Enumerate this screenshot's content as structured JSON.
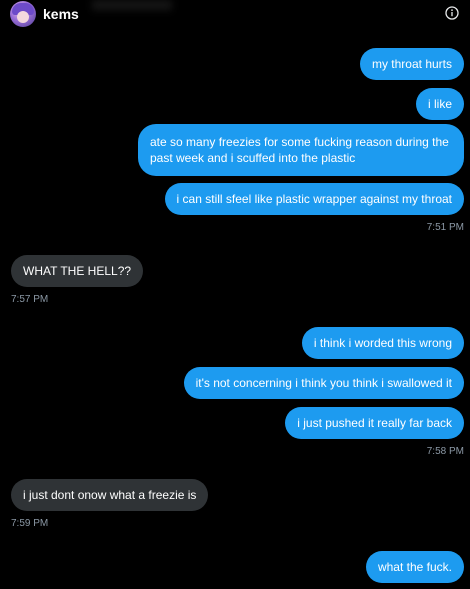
{
  "header": {
    "username": "kems",
    "info_icon": "info-circle-icon"
  },
  "messages": [
    {
      "side": "out",
      "text": "my throat hurts"
    },
    {
      "side": "out",
      "text": "i like"
    },
    {
      "side": "out",
      "text": "ate so many freezies for some fucking reason during the past week and i scuffed into the plastic"
    },
    {
      "side": "out",
      "text": "i can still sfeel like plastic wrapper against my throat"
    },
    {
      "side": "out",
      "timestamp": "7:51 PM"
    },
    {
      "side": "in",
      "text": "WHAT THE HELL??"
    },
    {
      "side": "in",
      "timestamp": "7:57 PM"
    },
    {
      "side": "out",
      "text": "i think i worded this wrong"
    },
    {
      "side": "out",
      "text": "it's not concerning i think you think i swallowed it"
    },
    {
      "side": "out",
      "text": "i just pushed it really far back"
    },
    {
      "side": "out",
      "timestamp": "7:58 PM"
    },
    {
      "side": "in",
      "text": "i just dont onow what a freezie is"
    },
    {
      "side": "in",
      "timestamp": "7:59 PM"
    },
    {
      "side": "out",
      "text": "what the fuck."
    }
  ],
  "colors": {
    "background": "#000000",
    "outgoing_bubble": "#1d9bf0",
    "incoming_bubble": "#2f3336",
    "timestamp": "#8b98a5"
  }
}
